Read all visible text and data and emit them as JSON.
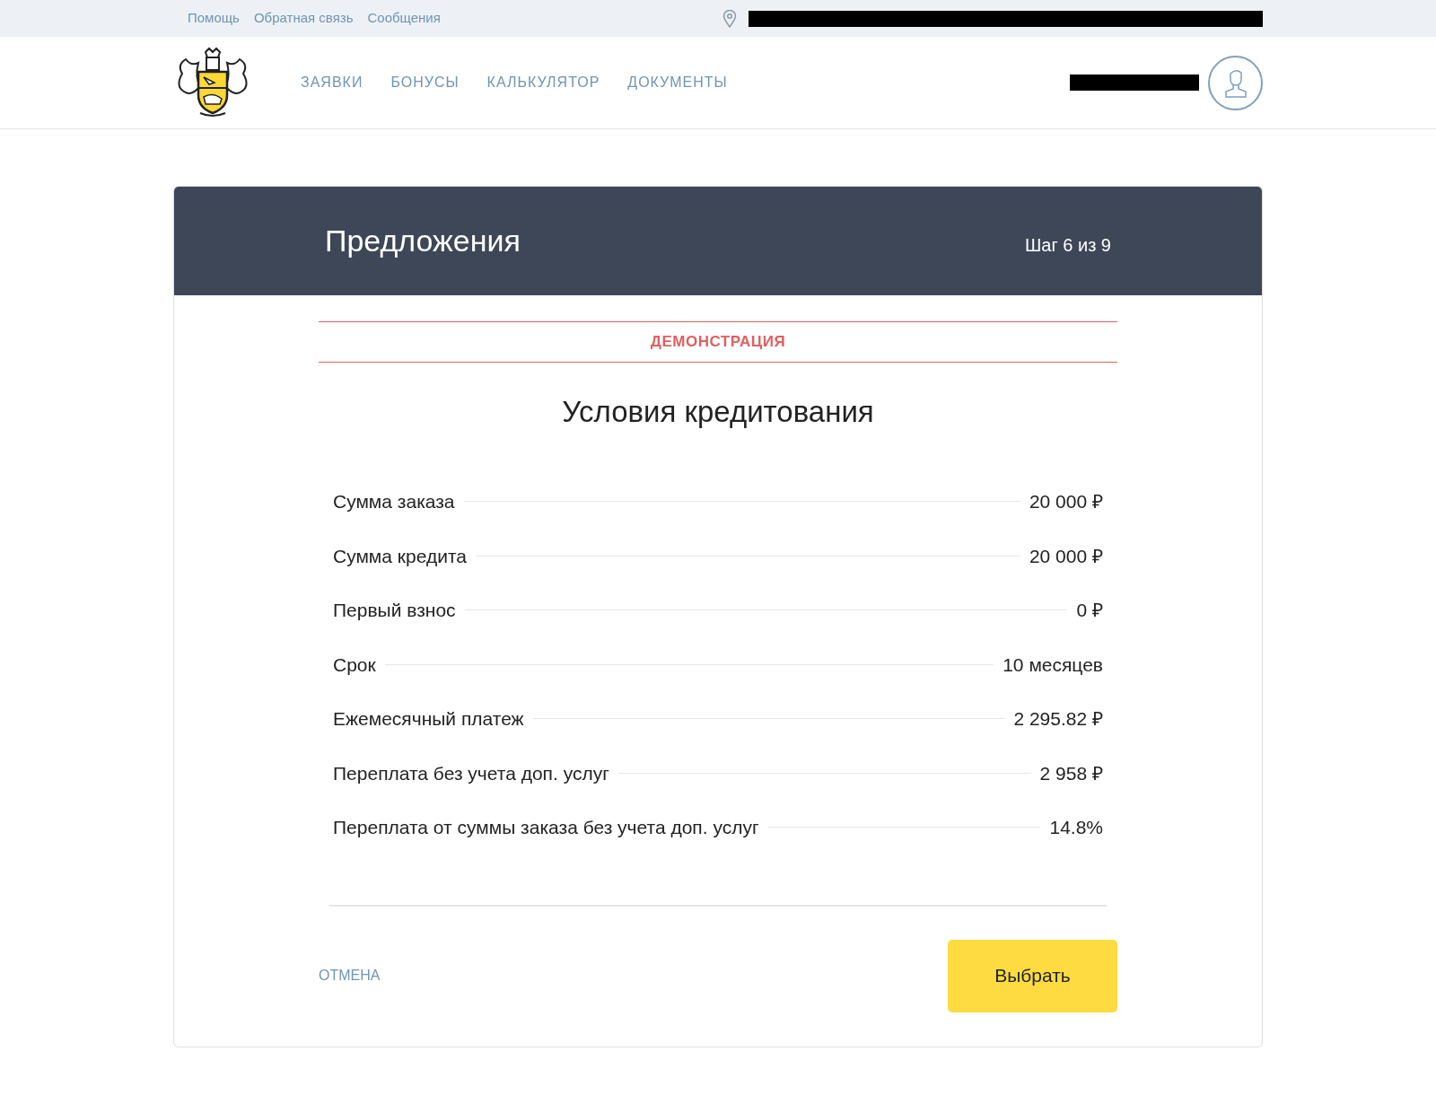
{
  "top_links": [
    "Помощь",
    "Обратная связь",
    "Сообщения"
  ],
  "nav": [
    "ЗАЯВКИ",
    "БОНУСЫ",
    "КАЛЬКУЛЯТОР",
    "ДОКУМЕНТЫ"
  ],
  "card": {
    "title": "Предложения",
    "step": "Шаг 6 из 9",
    "banner": "ДЕМОНСТРАЦИЯ",
    "heading": "Условия кредитования",
    "rows": [
      {
        "label": "Сумма заказа",
        "value": "20 000 ₽"
      },
      {
        "label": "Сумма кредита",
        "value": "20 000 ₽"
      },
      {
        "label": "Первый взнос",
        "value": "0 ₽"
      },
      {
        "label": "Срок",
        "value": "10 месяцев"
      },
      {
        "label": "Ежемесячный платеж",
        "value": "2 295.82 ₽"
      },
      {
        "label": "Переплата без учета доп. услуг",
        "value": "2 958 ₽"
      },
      {
        "label": "Переплата от суммы заказа без учета доп. услуг",
        "value": "14.8%"
      }
    ],
    "cancel": "ОТМЕНА",
    "submit": "Выбрать"
  }
}
